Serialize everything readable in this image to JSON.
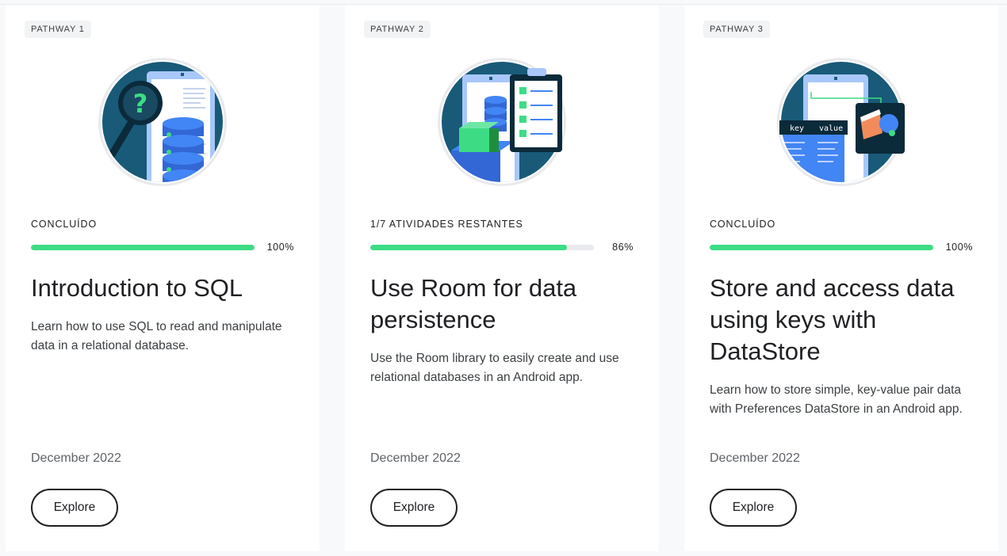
{
  "cards": [
    {
      "pathway": "PATHWAY 1",
      "status": "CONCLUÍDO",
      "progress_percent": 100,
      "progress_label": "100%",
      "title": "Introduction to SQL",
      "description": "Learn how to use SQL to read and manipulate data in a relational database.",
      "date": "December 2022",
      "button": "Explore",
      "illustration": "sql-database-magnifier-illustration"
    },
    {
      "pathway": "PATHWAY 2",
      "status": "1/7 ATIVIDADES RESTANTES",
      "progress_percent": 86,
      "progress_label": "86%",
      "title": "Use Room for data persistence",
      "description": "Use the Room library to easily create and use relational databases in an Android app.",
      "date": "December 2022",
      "button": "Explore",
      "illustration": "room-clipboard-database-illustration"
    },
    {
      "pathway": "PATHWAY 3",
      "status": "CONCLUÍDO",
      "progress_percent": 100,
      "progress_label": "100%",
      "title": "Store and access data using keys with DataStore",
      "description": "Learn how to store simple, key-value pair data with Preferences DataStore in an Android app.",
      "date": "December 2022",
      "button": "Explore",
      "illustration": "datastore-key-value-illustration",
      "illustration_labels": {
        "key": "key",
        "value": "value"
      }
    }
  ],
  "colors": {
    "progress_fill": "#3ddc84",
    "progress_track": "#e8eaed",
    "illustration_teal": "#1b5e7a",
    "illustration_blue": "#4285f4",
    "illustration_green": "#3ddc84"
  }
}
